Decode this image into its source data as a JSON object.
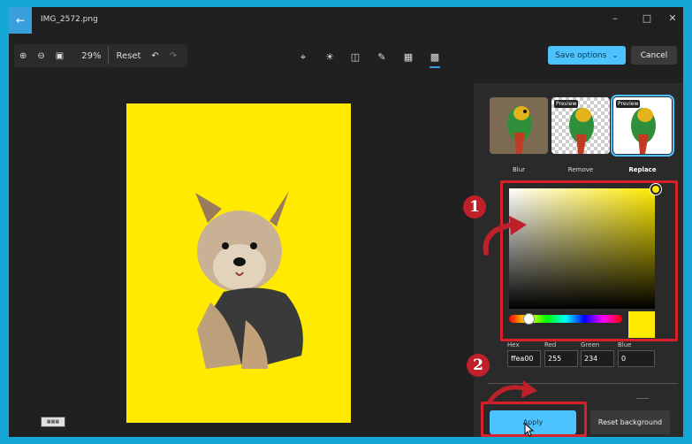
{
  "window": {
    "title": "IMG_2572.png"
  },
  "zoom": {
    "level": "29%",
    "reset_label": "Reset"
  },
  "header": {
    "save_label": "Save options",
    "cancel_label": "Cancel"
  },
  "background_options": [
    {
      "label": "Blur",
      "badge": ""
    },
    {
      "label": "Remove",
      "badge": "Preview"
    },
    {
      "label": "Replace",
      "badge": "Preview"
    }
  ],
  "color": {
    "value": "#ffea00",
    "hex_label": "Hex",
    "hex": "ffea00",
    "red_label": "Red",
    "red": "255",
    "green_label": "Green",
    "green": "234",
    "blue_label": "Blue",
    "blue": "0"
  },
  "actions": {
    "apply_label": "Apply",
    "reset_background_label": "Reset background"
  },
  "annotations": {
    "marker_1": "1",
    "marker_2": "2"
  },
  "icons": [
    "back-arrow-icon",
    "minimize-icon",
    "maximize-icon",
    "close-icon",
    "zoom-in-icon",
    "zoom-out-icon",
    "fit-icon",
    "undo-icon",
    "redo-icon",
    "crop-icon",
    "brightness-icon",
    "filter-icon",
    "markup-icon",
    "effects-icon",
    "background-icon",
    "chevron-down-icon"
  ]
}
